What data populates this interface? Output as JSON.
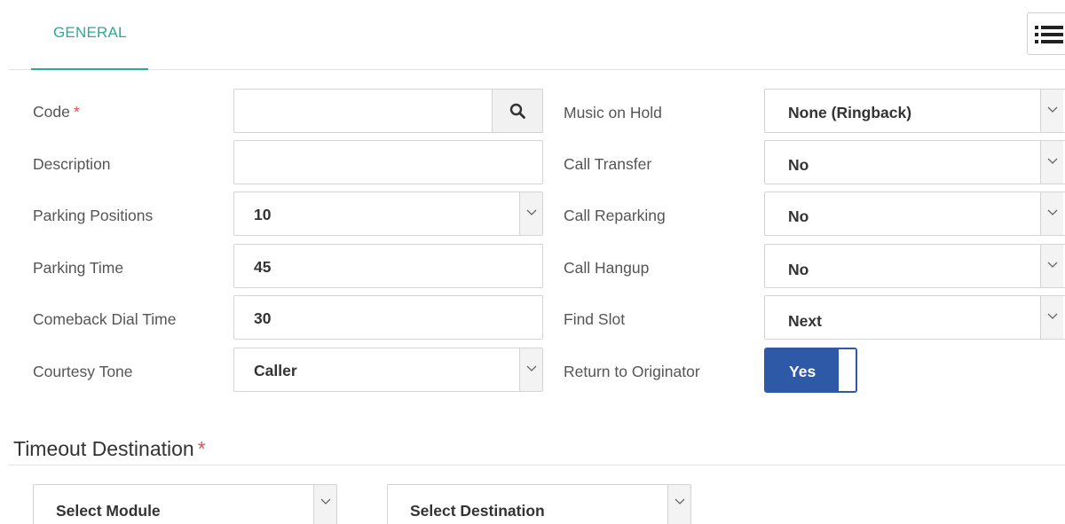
{
  "tabs": [
    {
      "label": "GENERAL"
    }
  ],
  "toolbar": {
    "menu_icon": "list-icon"
  },
  "left_form": {
    "code": {
      "label": "Code",
      "required_mark": "*",
      "value": ""
    },
    "description": {
      "label": "Description",
      "value": ""
    },
    "parking_positions": {
      "label": "Parking Positions",
      "value": "10"
    },
    "parking_time": {
      "label": "Parking Time",
      "value": "45"
    },
    "comeback_dial_time": {
      "label": "Comeback Dial Time",
      "value": "30"
    },
    "courtesy_tone": {
      "label": "Courtesy Tone",
      "value": "Caller"
    }
  },
  "right_form": {
    "music_on_hold": {
      "label": "Music on Hold",
      "value": "None (Ringback)"
    },
    "call_transfer": {
      "label": "Call Transfer",
      "value": "No"
    },
    "call_reparking": {
      "label": "Call Reparking",
      "value": "No"
    },
    "call_hangup": {
      "label": "Call Hangup",
      "value": "No"
    },
    "find_slot": {
      "label": "Find Slot",
      "value": "Next"
    },
    "return_to_originator": {
      "label": "Return to Originator",
      "value": "Yes"
    }
  },
  "timeout_destination": {
    "title": "Timeout Destination",
    "required_mark": "*",
    "module_select": "Select Module",
    "destination_select": "Select Destination"
  },
  "colors": {
    "accent": "#2ba99b",
    "toggle": "#2e59a7",
    "required": "#d9534f"
  }
}
